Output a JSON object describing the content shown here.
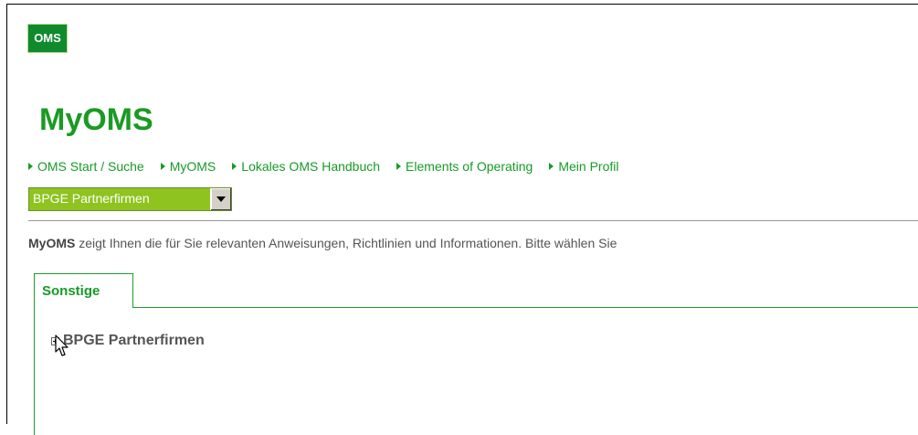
{
  "logo": {
    "text": "OMS"
  },
  "page": {
    "title": "MyOMS"
  },
  "nav": {
    "items": [
      {
        "label": "OMS Start / Suche"
      },
      {
        "label": "MyOMS"
      },
      {
        "label": "Lokales OMS Handbuch"
      },
      {
        "label": "Elements of Operating"
      },
      {
        "label": "Mein Profil"
      }
    ]
  },
  "selector": {
    "value": "BPGE Partnerfirmen"
  },
  "intro": {
    "bold": "MyOMS",
    "text": " zeigt Ihnen die für Sie relevanten Anweisungen, Richtlinien und Informationen. Bitte wählen Sie"
  },
  "tabs": [
    {
      "label": "Sonstige"
    }
  ],
  "tree": {
    "item_label": "BPGE Partnerfirmen"
  },
  "colors": {
    "brand_green": "#169b27",
    "logo_bg": "#0f8a2c",
    "select_bg": "#8fc31f"
  }
}
